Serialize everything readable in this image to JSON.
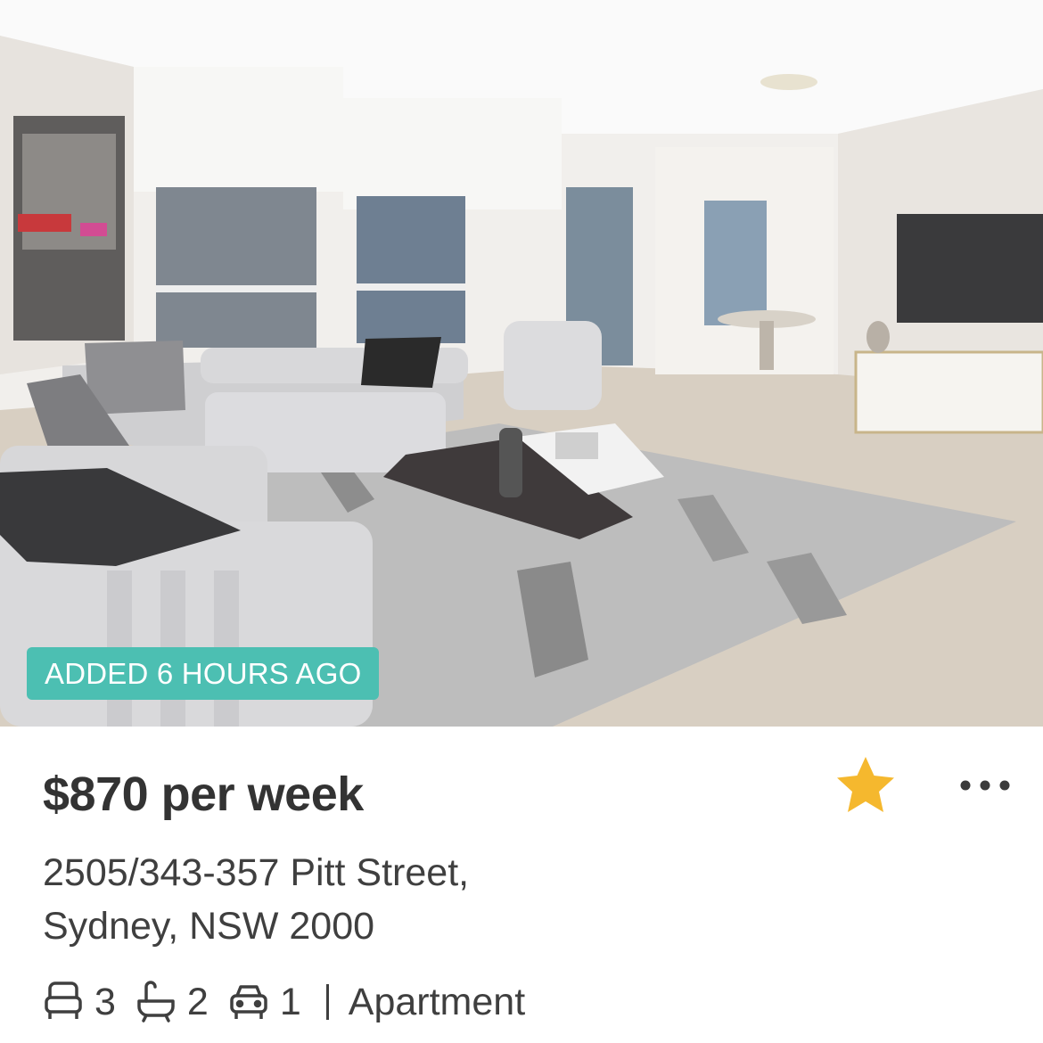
{
  "listing": {
    "badge": "ADDED 6 HOURS AGO",
    "price": "$870 per week",
    "address_line1": "2505/343-357 Pitt Street,",
    "address_line2": "Sydney, NSW 2000",
    "bedrooms": "3",
    "bathrooms": "2",
    "parking": "1",
    "property_type": "Apartment",
    "favourited": true
  },
  "icons": {
    "favourite": "star-icon",
    "more": "more-options-icon",
    "bed": "bed-icon",
    "bath": "bath-icon",
    "car": "car-icon"
  },
  "colors": {
    "badge_bg": "#4cbfb2",
    "star": "#f5b82e",
    "text": "#3b3b3b"
  }
}
